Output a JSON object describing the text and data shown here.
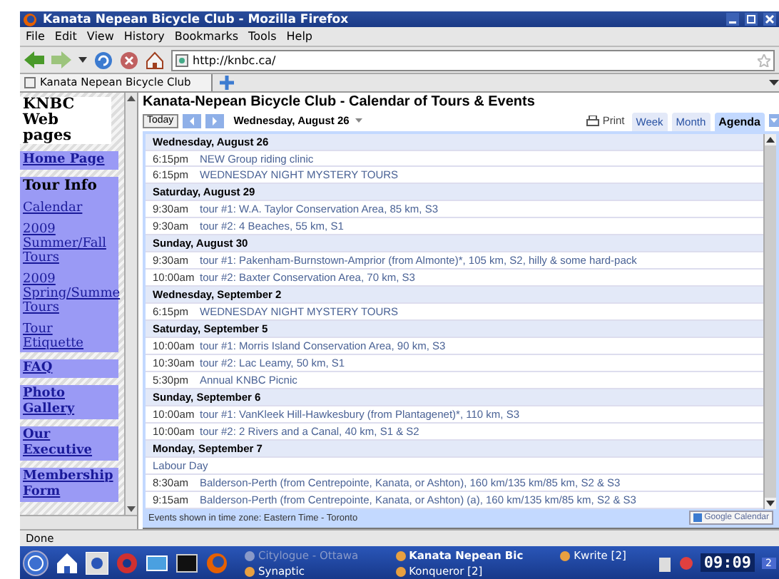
{
  "window": {
    "title": "Kanata Nepean Bicycle Club - Mozilla Firefox"
  },
  "menu": [
    "File",
    "Edit",
    "View",
    "History",
    "Bookmarks",
    "Tools",
    "Help"
  ],
  "address": {
    "value": "http://knbc.ca/"
  },
  "tabs": [
    {
      "label": "Kanata Nepean Bicycle Club",
      "selected": true
    }
  ],
  "sidebar": {
    "title": "KNBC Web pages",
    "sections": [
      {
        "kind": "bold",
        "links": [
          "Home Page"
        ]
      },
      {
        "kind": "group",
        "heading": "Tour Info",
        "links": [
          "Calendar",
          "2009 Summer/Fall Tours",
          "2009 Spring/Summe Tours",
          "Tour Etiquette"
        ]
      },
      {
        "kind": "bold",
        "links": [
          "FAQ"
        ]
      },
      {
        "kind": "bold",
        "links": [
          "Photo Gallery"
        ]
      },
      {
        "kind": "bold",
        "links": [
          "Our Executive"
        ]
      },
      {
        "kind": "bold",
        "links": [
          "Membership Form"
        ]
      }
    ]
  },
  "calendar": {
    "title": "Kanata-Nepean Bicycle Club - Calendar of Tours & Events",
    "today": "Today",
    "date": "Wednesday, August 26",
    "print": "Print",
    "views": [
      {
        "label": "Week",
        "selected": false
      },
      {
        "label": "Month",
        "selected": false
      },
      {
        "label": "Agenda",
        "selected": true
      }
    ],
    "days": [
      {
        "date": "Wednesday, August 26",
        "events": [
          {
            "time": "6:15pm",
            "title": "NEW Group riding clinic"
          },
          {
            "time": "6:15pm",
            "title": "WEDNESDAY NIGHT MYSTERY TOURS"
          }
        ]
      },
      {
        "date": "Saturday, August 29",
        "events": [
          {
            "time": "9:30am",
            "title": "tour #1: W.A. Taylor Conservation Area, 85 km, S3"
          },
          {
            "time": "9:30am",
            "title": "tour #2: 4 Beaches, 55 km, S1"
          }
        ]
      },
      {
        "date": "Sunday, August 30",
        "events": [
          {
            "time": "9:30am",
            "title": "tour #1: Pakenham-Burnstown-Amprior (from Almonte)*, 105 km, S2, hilly & some hard-pack"
          },
          {
            "time": "10:00am",
            "title": "tour #2: Baxter Conservation Area, 70 km, S3"
          }
        ]
      },
      {
        "date": "Wednesday, September 2",
        "events": [
          {
            "time": "6:15pm",
            "title": "WEDNESDAY NIGHT MYSTERY TOURS"
          }
        ]
      },
      {
        "date": "Saturday, September 5",
        "events": [
          {
            "time": "10:00am",
            "title": "tour #1: Morris Island Conservation Area, 90 km, S3"
          },
          {
            "time": "10:30am",
            "title": "tour #2: Lac Leamy, 50 km, S1"
          },
          {
            "time": "5:30pm",
            "title": "Annual KNBC Picnic"
          }
        ]
      },
      {
        "date": "Sunday, September 6",
        "events": [
          {
            "time": "10:00am",
            "title": "tour #1: VanKleek Hill-Hawkesbury (from Plantagenet)*, 110 km, S3"
          },
          {
            "time": "10:00am",
            "title": "tour #2: 2 Rivers and a Canal, 40 km, S1 & S2"
          }
        ]
      },
      {
        "date": "Monday, September 7",
        "events": [
          {
            "title": "Labour Day"
          },
          {
            "time": "8:30am",
            "title": "Balderson-Perth (from Centrepointe, Kanata, or Ashton), 160 km/135 km/85 km, S2 & S3"
          },
          {
            "time": "9:15am",
            "title": "Balderson-Perth (from Centrepointe, Kanata, or Ashton) (a), 160 km/135 km/85 km, S2 & S3"
          }
        ]
      }
    ],
    "timezone": "Events shown in time zone: Eastern Time - Toronto",
    "badge": "Google Calendar"
  },
  "status_bar": "Done",
  "taskbar": {
    "tasks": [
      {
        "label": "Citylogue - Ottawa",
        "selected": false,
        "dimmed": true
      },
      {
        "label": "Kanata Nepean Bic",
        "selected": true,
        "dimmed": false
      },
      {
        "label": "Kwrite [2]",
        "selected": false,
        "dimmed": false
      },
      {
        "label": "Synaptic",
        "selected": false,
        "dimmed": false
      },
      {
        "label": "Konqueror [2]",
        "selected": false,
        "dimmed": false
      }
    ],
    "clock": "09:09",
    "desktop": "2"
  }
}
